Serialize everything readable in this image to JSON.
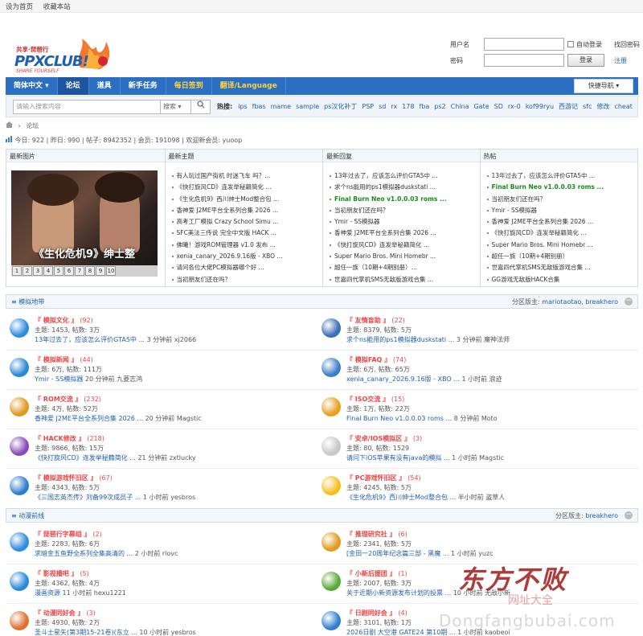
{
  "topbar": {
    "set_home": "设为首页",
    "bookmark": "收藏本站"
  },
  "logo": {
    "slogan": "共享·琵琶行",
    "brand": "PPXCLUB!",
    "tagline": "SHARE YOURSELF"
  },
  "login": {
    "username_label": "用户名",
    "password_label": "密码",
    "auto_login": "自动登录",
    "retrieve": "找回密码",
    "login_button": "登录",
    "register": "注册"
  },
  "nav": {
    "items": [
      "简体中文 ▾",
      "论坛",
      "道具",
      "新手任务",
      "每日签到",
      "翻译/Language"
    ],
    "quick": "快捷导航 ▾"
  },
  "search": {
    "placeholder": "请输入搜索内容",
    "type": "搜索 ▾",
    "hot_label": "热搜:",
    "keywords": [
      "ips",
      "fbas",
      "mame",
      "sample",
      "ps汉化补丁",
      "PSP",
      "sd",
      "rx",
      "178",
      "fba",
      "ps2",
      "China",
      "Gate",
      "SD",
      "rx-0",
      "kof99ryu",
      "西游记",
      "sfc",
      "修改",
      "cheat"
    ]
  },
  "breadcrumb": "论坛",
  "stats": "今日: 922 | 昨日: 990 | 帖子: 8942352 | 会员: 191098 | 欢迎新会员: yuoop",
  "panels": {
    "pics": {
      "title": "最新图片",
      "caption": "《生化危机9》绅士整",
      "nums": [
        "1",
        "2",
        "3",
        "4",
        "5",
        "6",
        "7",
        "8",
        "9",
        "10"
      ]
    },
    "new_topics": {
      "title": "最新主题",
      "items": [
        "有人玩过国产街机 时迷飞车 吗？...",
        "《快打旋风CD》连发举秘籍简化 ...",
        "《生化危机9》西川绅士Mod整合包 ...",
        "香神爱 J2ME平台全系列合集 2026 ...",
        "高考工厂模拟 Crazy School Simu ...",
        "SFC美法三传说 完全中文版 HACK ...",
        "佛曦！游戏ROM管理器 v1.0 发布 ...",
        "xenia_canary_2026.9.16版 - XBO ...",
        "请问各位大佬PC模拟器哪个好 ...",
        "当初朋友们还在吗？"
      ]
    },
    "new_replies": {
      "title": "最新回复",
      "items": [
        "13年过去了，应该怎么评价GTA5中 ...",
        "求个ns能用的ps1模拟器duskstati ...",
        "Final Burn Neo v1.0.0.03 roms ...",
        "当初朋友们还在吗？",
        "Ymir - SS模拟器",
        "香神爱 J2ME平台全系列合集 2026 ...",
        "《快打旋风CD》连发举秘籍简化 ...",
        "Super Mario Bros. Mini Homebr ...",
        "超任一族（10期+4期别册）...",
        "世嘉四代掌机SMS无敌版游戏合集 ..."
      ],
      "highlight": [
        2
      ]
    },
    "hot": {
      "title": "热帖",
      "items": [
        "13年过去了，应该怎么评价GTA5中 ...",
        "Final Burn Neo v1.0.0.03 roms ...",
        "当初朋友们还在吗？",
        "Ymir - SS模拟器",
        "香神爱 J2ME平台全系列合集 2026 ...",
        "《快打旋风CD》连发举秘籍简化 ...",
        "Super Mario Bros. Mini Homebr ...",
        "超任一族（10期+4期别册）",
        "世嘉四代掌机SMS无敌版游戏合集 ...",
        "GG游戏无敌版HACK合集"
      ],
      "highlight": [
        1
      ]
    }
  },
  "sections": [
    {
      "title": "模拟地带",
      "mod_label": "分区版主:",
      "mods": "mariotaotao, breakhero",
      "forums": [
        {
          "name": "『 模拟文化 』",
          "count": "(92)",
          "meta": "主题: 1453, 帖数: 3万",
          "last": "13年过去了，应该怎么评价GTA5中 ...",
          "time": "3 分钟前 xj2066",
          "color": "#2f8ce0"
        },
        {
          "name": "『 友情盲助 』",
          "count": "(22)",
          "meta": "主题: 8379, 帖数: 5万",
          "last": "求个ns能用的ps1模拟器duskstati ...",
          "time": "3 分钟前 魔神法师",
          "color": "#3b6fb8"
        },
        {
          "name": "『 模拟新闻 』",
          "count": "(44)",
          "meta": "主题: 6万, 帖数: 111万",
          "last": "Ymir - SS模拟器",
          "time": "20 分钟前 九菱志鸿",
          "color": "#2a8ad6"
        },
        {
          "name": "『 模拟FAQ 』",
          "count": "(74)",
          "meta": "主题: 6万, 帖数: 65万",
          "last": "xenia_canary_2026.9.16版 - XBO ...",
          "time": "1 小时前 浪迹",
          "color": "#3d7ec8"
        },
        {
          "name": "『 ROM交流 』",
          "count": "(232)",
          "meta": "主题: 4万, 帖数: 52万",
          "last": "香神爱 J2ME平台全系列合集 2026 ...",
          "time": "20 分钟前 Magstic",
          "color": "#e09a20"
        },
        {
          "name": "『 ISO交流 』",
          "count": "(15)",
          "meta": "主题: 1万, 帖数: 22万",
          "last": "Final Burn Neo v1.0.0.03 roms ...",
          "time": "8 分钟前 Moto",
          "color": "#e8a020"
        },
        {
          "name": "『 HACK修改 』",
          "count": "(218)",
          "meta": "主题: 9866, 帖数: 15万",
          "last": "《快打旋风CD》连发举秘籍简化 ...",
          "time": "21 分钟前 zxtlucky",
          "color": "#8a4ab8"
        },
        {
          "name": "『 安卓/IOS模拟区 』",
          "count": "(3)",
          "meta": "主题: 80, 帖数: 1529",
          "last": "请问下iOS苹果有没有java的模拟 ...",
          "time": "1 小时前 Magstic",
          "color": "#c8c8c8"
        },
        {
          "name": "『 模拟游戏怀旧区 』",
          "count": "(67)",
          "meta": "主题: 4343, 帖数: 5万",
          "last": "《三国志英杰传》刘备99次成员子 ...",
          "time": "1 小时前 yesbros",
          "color": "#2f7fd0"
        },
        {
          "name": "『 PC游戏怀旧区 』",
          "count": "(54)",
          "meta": "主题: 4245, 帖数: 5万",
          "last": "《生化危机9》西川绅士Mod整合包 ...",
          "time": "半小时前 盗草人",
          "color": "#f4c020"
        }
      ]
    },
    {
      "title": "动漫前线",
      "mod_label": "分区版主:",
      "mods": "breakhero",
      "forums": [
        {
          "name": "『 琵琶行字幕组 』",
          "count": "(2)",
          "meta": "主题: 2283, 帖数: 6万",
          "last": "求暗金五鱼野全系列全集高清的 ...",
          "time": "2 小时前 rlovc",
          "color": "#2f8ce0"
        },
        {
          "name": "『 推理研究社 』",
          "count": "(6)",
          "meta": "主题: 2341, 帖数: 5万",
          "last": "[金田一20周年纪念篇三部 - 黑魔 ...",
          "time": "1 小时前 yuzc",
          "color": "#e09a20"
        },
        {
          "name": "『 影视播吧 』",
          "count": "(5)",
          "meta": "主题: 4362, 帖数: 4万",
          "last": "漫画资源",
          "time": "11 小时前 hexu1221",
          "color": "#2a8ad6"
        },
        {
          "name": "『 小新后援团 』",
          "count": "(1)",
          "meta": "主题: 2007, 帖数: 3万",
          "last": "关于近期小新资源发布计划的投票 ...",
          "time": "10 小时前 无敌小新",
          "color": "#5aaa3a"
        },
        {
          "name": "『 动漫同好会 』",
          "count": "(3)",
          "meta": "主题: 4930, 帖数: 2万",
          "last": "圣斗士星矢(第3期15-21卷)(东立 ...",
          "time": "10 小时前 yesbros",
          "color": "#e07030"
        },
        {
          "name": "『 日剧同好会 』",
          "count": "(4)",
          "meta": "主题: 3101, 帖数: 1万",
          "last": "2026日剧 大空港 GATE24 第10期 ...",
          "time": "1 小时前 kaobeoi",
          "color": "#2f7fd0"
        }
      ]
    }
  ],
  "watermark": {
    "main": "东方不败",
    "sub": "网址大全",
    "url": "Dongfangbubai.com"
  }
}
